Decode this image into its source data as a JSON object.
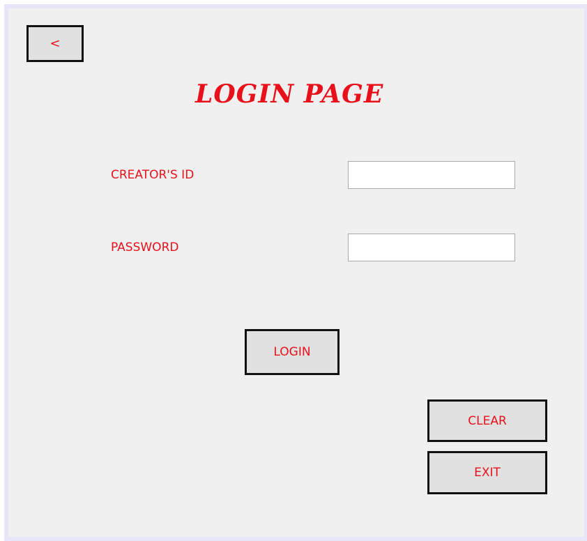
{
  "header": {
    "back_label": "<",
    "title": "LOGIN PAGE"
  },
  "form": {
    "creator_id_label": "CREATOR'S ID",
    "creator_id_value": "",
    "password_label": "PASSWORD",
    "password_value": ""
  },
  "actions": {
    "login_label": "LOGIN",
    "clear_label": "CLEAR",
    "exit_label": "EXIT"
  },
  "colors": {
    "accent_text": "#e8101a",
    "panel_background": "#f0f0f0",
    "button_background": "#e1e1e1",
    "button_border": "#111111"
  }
}
